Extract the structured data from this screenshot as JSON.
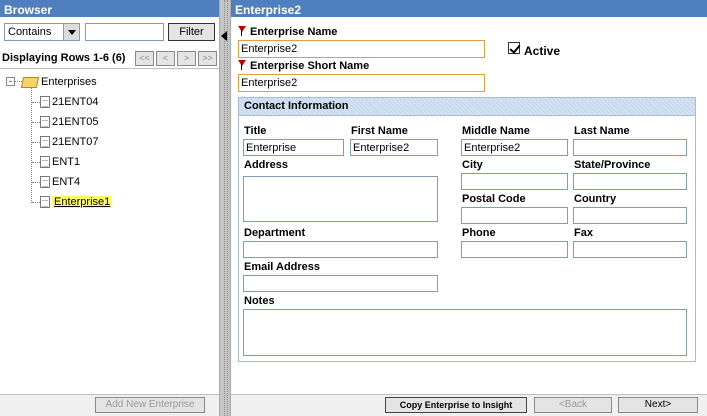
{
  "browser": {
    "title": "Browser",
    "filter_select": "Contains",
    "filter_value": "",
    "filter_button": "Filter",
    "rows_label": "Displaying Rows 1-6 (6)",
    "pager": [
      "<<",
      "<",
      ">",
      ">>"
    ],
    "tree_root": "Enterprises",
    "tree_expand": "-",
    "tree_items": [
      "21ENT04",
      "21ENT05",
      "21ENT07",
      "ENT1",
      "ENT4",
      "Enterprise1"
    ],
    "add_button": "Add New Enterprise"
  },
  "form": {
    "title": "Enterprise2",
    "enterprise_name_label": "Enterprise Name",
    "enterprise_name_value": "Enterprise2",
    "active_label": "Active",
    "active_checked": true,
    "short_name_label": "Enterprise Short Name",
    "short_name_value": "Enterprise2",
    "contact": {
      "title": "Contact Information",
      "title_label": "Title",
      "title_value": "Enterprise",
      "first_name_label": "First Name",
      "first_name_value": "Enterprise2",
      "middle_name_label": "Middle Name",
      "middle_name_value": "Enterprise2",
      "last_name_label": "Last Name",
      "last_name_value": "",
      "address_label": "Address",
      "city_label": "City",
      "state_label": "State/Province",
      "postal_label": "Postal Code",
      "country_label": "Country",
      "department_label": "Department",
      "phone_label": "Phone",
      "fax_label": "Fax",
      "email_label": "Email Address",
      "notes_label": "Notes"
    }
  },
  "footer": {
    "copy_button": "Copy Enterprise to Insight",
    "back_button": "<Back",
    "next_button": "Next>"
  },
  "colors": {
    "header": "#4f7fbf",
    "splitter": "#c6c6c6",
    "required_border": "#e0a040",
    "selected_highlight": "#ffff66",
    "contact_header": "#c9d9ef"
  }
}
